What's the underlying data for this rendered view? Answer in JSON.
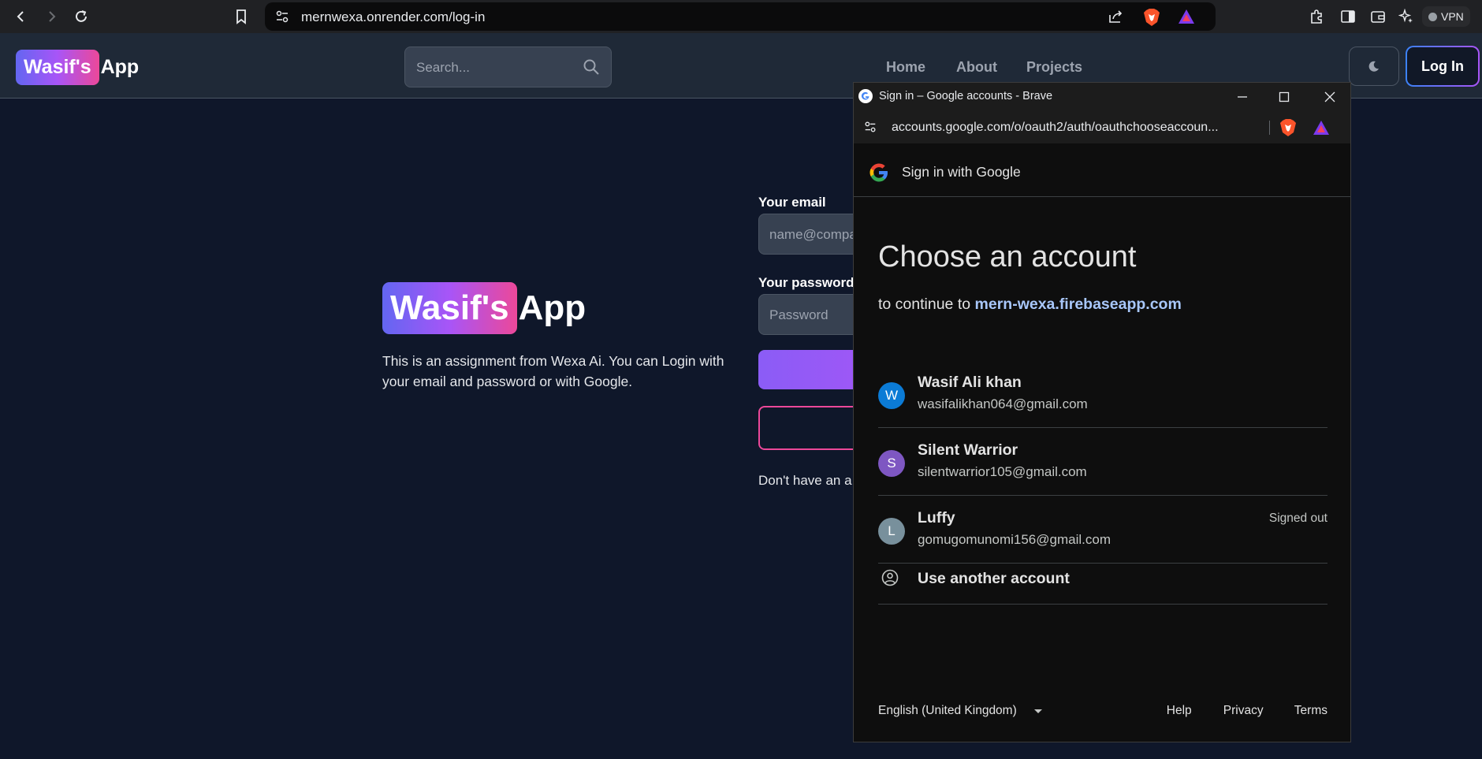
{
  "browser": {
    "url": "mernwexa.onrender.com/log-in",
    "vpn_label": "VPN"
  },
  "header": {
    "logo_badge": "Wasif's",
    "logo_rest": "App",
    "search_placeholder": "Search...",
    "nav": [
      "Home",
      "About",
      "Projects"
    ],
    "login_label": "Log In"
  },
  "main": {
    "logo_badge": "Wasif's",
    "logo_rest": "App",
    "description": "This is an assignment from Wexa Ai. You can Login with your email and password or with Google.",
    "email_label": "Your email",
    "email_placeholder": "name@compa",
    "password_label": "Your password",
    "password_placeholder": "Password",
    "signup_text": "Don't have an a"
  },
  "popup": {
    "window_title": "Sign in – Google accounts - Brave",
    "url": "accounts.google.com/o/oauth2/auth/oauthchooseaccoun...",
    "header_text": "Sign in with Google",
    "title": "Choose an account",
    "continue_prefix": "to continue to",
    "continue_link": "mern-wexa.firebaseapp.com",
    "accounts": [
      {
        "initial": "W",
        "name": "Wasif Ali khan",
        "email": "wasifalikhan064@gmail.com",
        "status": "",
        "color": "#1a73e8"
      },
      {
        "initial": "S",
        "name": "Silent Warrior",
        "email": "silentwarrior105@gmail.com",
        "status": "",
        "color": "#7e57c2"
      },
      {
        "initial": "L",
        "name": "Luffy",
        "email": "gomugomunomi156@gmail.com",
        "status": "Signed out",
        "color": "#78909c"
      }
    ],
    "another_account": "Use another account",
    "language": "English (United Kingdom)",
    "footer_links": [
      "Help",
      "Privacy",
      "Terms"
    ]
  },
  "colors": {
    "page_bg": "#0f172a",
    "accent_gradient_start": "#6366f1",
    "accent_gradient_end": "#ec4899",
    "google_link": "#a8c7fa"
  }
}
